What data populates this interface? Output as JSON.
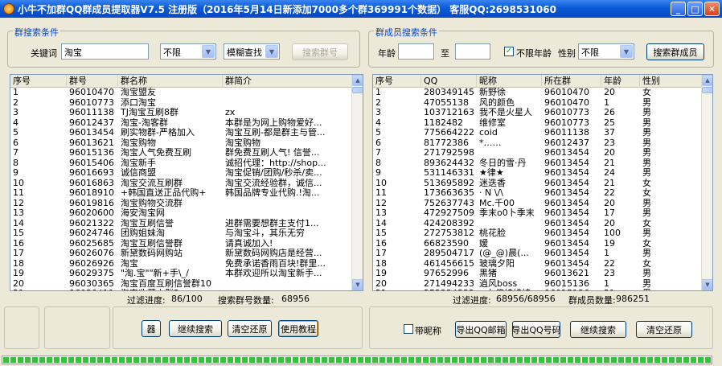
{
  "window": {
    "title": "小牛不加群QQ群成员提取器V7.5    注册版（2016年5月14日新添加7000多个群369991个数据）   客服QQ:2698531060",
    "minimize": "_",
    "maximize": "□",
    "close": "✕"
  },
  "group_search": {
    "title": "群搜索条件",
    "keyword_label": "关键词",
    "keyword_value": "淘宝",
    "filter_value": "不限",
    "mode_value": "模糊查找",
    "search_button": "搜索群号",
    "columns": [
      "序号",
      "群号",
      "群名称",
      "群简介"
    ],
    "rows": [
      [
        "1",
        "96010470",
        "淘宝盟友",
        ""
      ],
      [
        "2",
        "96010773",
        "添口淘宝",
        ""
      ],
      [
        "3",
        "96011138",
        "TJ淘宝互刷8群",
        "zx"
      ],
      [
        "4",
        "96012437",
        "淘宝-淘客群",
        "本群是为网上购物爱好..."
      ],
      [
        "5",
        "96013454",
        "刷实物群-严格加入",
        "淘宝互刷-都是群主与管..."
      ],
      [
        "6",
        "96013621",
        "淘宝购物",
        "淘宝购物"
      ],
      [
        "7",
        "96015136",
        "淘宝人气免费互刷",
        "群免费互刷人气! 信誉..."
      ],
      [
        "8",
        "96015406",
        "淘宝新手",
        "诚招代理：http://shop..."
      ],
      [
        "9",
        "96016693",
        "诚信商盟",
        "淘宝促销/团购/秒杀/卖..."
      ],
      [
        "10",
        "96016863",
        "淘宝交流互刷群",
        "淘宝交流经验群，诚信..."
      ],
      [
        "11",
        "96018910",
        "+韩国直送正品代购+",
        "韩国品牌专业代购.!淘..."
      ],
      [
        "12",
        "96019816",
        "淘宝购物交流群",
        ""
      ],
      [
        "13",
        "96020600",
        "海安淘宝网",
        ""
      ],
      [
        "14",
        "96021322",
        "淘宝互刷信誉",
        "进群需要想群主支付1..."
      ],
      [
        "15",
        "96024746",
        "团购姐妹淘",
        "与淘宝斗，其乐无穷"
      ],
      [
        "16",
        "96025685",
        "淘宝互刷信誉群",
        "请真诚加入!"
      ],
      [
        "17",
        "96026076",
        "新黛数码网购站",
        "新黛数码网购店是经营..."
      ],
      [
        "18",
        "96026926",
        "淘宝",
        "免费承诺香雨百块!群里..."
      ],
      [
        "19",
        "96029375",
        "\"淘.宝\"\"新+手\\_/",
        "本群欢迎所以淘宝新手..."
      ],
      [
        "20",
        "96030365",
        "淘宝百度互刷信誉群10",
        ""
      ],
      [
        "21",
        "96030411",
        "淘宝收藏大群2",
        ""
      ]
    ],
    "progress_label": "过滤进度:",
    "progress_value": "86/100",
    "count_label": "搜索群号数量:",
    "count_value": "68956"
  },
  "member_search": {
    "title": "群成员搜索条件",
    "age_label": "年龄",
    "age_from": "",
    "to_label": "至",
    "age_to": "",
    "unlimited_age_label": "不限年龄",
    "unlimited_age_checked": true,
    "gender_label": "性别",
    "gender_value": "不限",
    "search_button": "搜索群成员",
    "columns": [
      "序号",
      "QQ",
      "昵称",
      "所在群",
      "年龄",
      "性别"
    ],
    "rows": [
      [
        "1",
        "280349145",
        "新野徐",
        "96010470",
        "20",
        "女"
      ],
      [
        "2",
        "47055138",
        "风的颜色",
        "96010470",
        "1",
        "男"
      ],
      [
        "3",
        "103712163",
        "我不是火星人",
        "96010773",
        "26",
        "男"
      ],
      [
        "4",
        "1182482",
        "维修室",
        "96010773",
        "25",
        "男"
      ],
      [
        "5",
        "775664222",
        "coid",
        "96011138",
        "37",
        "男"
      ],
      [
        "6",
        "81772386",
        "*……",
        "96012437",
        "23",
        "男"
      ],
      [
        "7",
        "271792598",
        "",
        "96013454",
        "20",
        "男"
      ],
      [
        "8",
        "893624432",
        "冬日的雪·丹",
        "96013454",
        "21",
        "男"
      ],
      [
        "9",
        "531146331",
        "★律★",
        "96013454",
        "24",
        "男"
      ],
      [
        "10",
        "513695892",
        "迷迭香",
        "96013454",
        "21",
        "女"
      ],
      [
        "11",
        "173663635",
        "·  N \\/\\",
        "96013454",
        "22",
        "女"
      ],
      [
        "12",
        "752637743",
        "Mc.千00",
        "96013454",
        "20",
        "男"
      ],
      [
        "13",
        "472927509",
        "季末o0卜季末",
        "96013454",
        "17",
        "男"
      ],
      [
        "14",
        "424208392",
        "",
        "96013454",
        "20",
        "女"
      ],
      [
        "15",
        "272753812",
        "桃花脸",
        "96013454",
        "100",
        "男"
      ],
      [
        "16",
        "66823590",
        "嫒",
        "96013454",
        "19",
        "女"
      ],
      [
        "17",
        "289504717",
        "(@_@)晨(...",
        "96013454",
        "1",
        "男"
      ],
      [
        "18",
        "461456615",
        "玻璃夕阳",
        "96013454",
        "22",
        "女"
      ],
      [
        "19",
        "97652996",
        "黑猪",
        "96013621",
        "23",
        "男"
      ],
      [
        "20",
        "271494233",
        "逍风boss",
        "96015136",
        "1",
        "男"
      ],
      [
        "21",
        "252224332",
        "~卜傻娃娃娃",
        "96015136",
        "21",
        "男"
      ]
    ],
    "progress_label": "过滤进度:",
    "progress_value": "68956/68956",
    "count_label": "群成员数量:",
    "count_value": "986251"
  },
  "bottom_left": {
    "partial_button": "器",
    "continue_button": "继续搜索",
    "clear_button": "清空还原",
    "tutorial_button": "使用教程"
  },
  "bottom_right": {
    "nickname_label": "带昵称",
    "export_email_button": "导出QQ邮箱",
    "export_qq_button": "导出QQ号码",
    "continue_button": "继续搜索",
    "clear_button": "清空还原"
  },
  "progress_bar": {
    "percent": 100
  }
}
